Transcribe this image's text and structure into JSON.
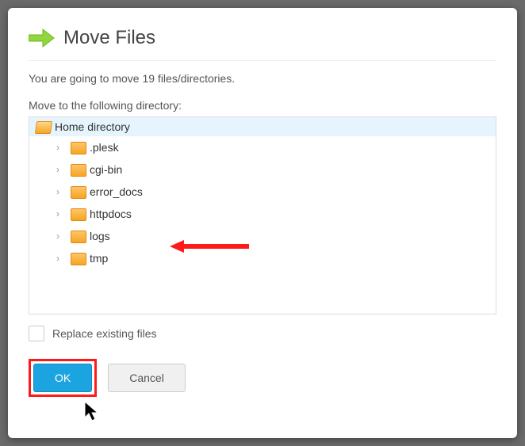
{
  "dialog": {
    "title": "Move Files",
    "message": "You are going to move 19 files/directories.",
    "subhead": "Move to the following directory:"
  },
  "tree": {
    "root_label": "Home directory",
    "items": [
      {
        "label": ".plesk"
      },
      {
        "label": "cgi-bin"
      },
      {
        "label": "error_docs"
      },
      {
        "label": "httpdocs"
      },
      {
        "label": "logs"
      },
      {
        "label": "tmp"
      }
    ]
  },
  "options": {
    "replace_label": "Replace existing files"
  },
  "buttons": {
    "ok": "OK",
    "cancel": "Cancel"
  }
}
